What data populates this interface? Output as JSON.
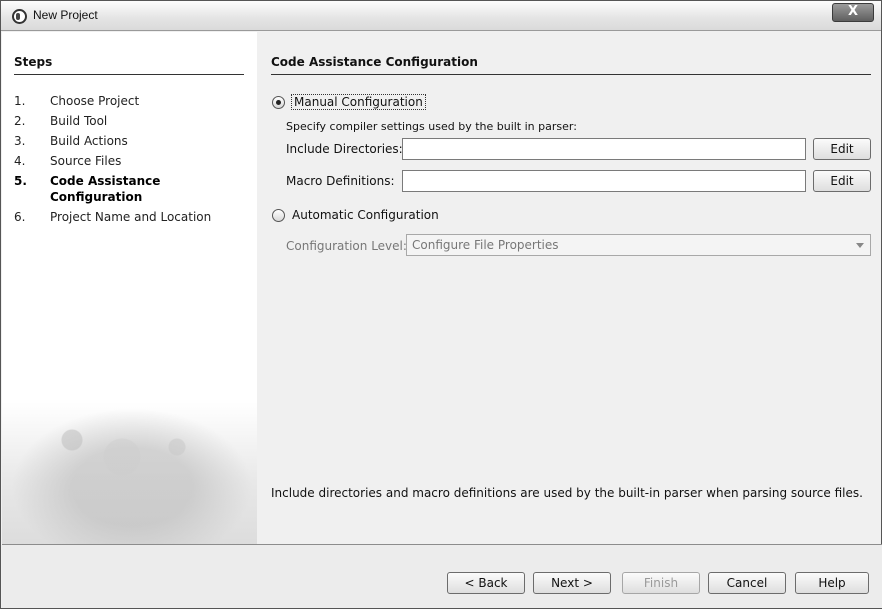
{
  "window": {
    "title": "New Project",
    "close_label": "X"
  },
  "steps": {
    "title": "Steps",
    "items": [
      {
        "num": "1.",
        "label": "Choose Project"
      },
      {
        "num": "2.",
        "label": "Build Tool"
      },
      {
        "num": "3.",
        "label": "Build Actions"
      },
      {
        "num": "4.",
        "label": "Source Files"
      },
      {
        "num": "5.",
        "label": "Code Assistance Configuration",
        "current": true
      },
      {
        "num": "6.",
        "label": "Project Name and Location"
      }
    ]
  },
  "main": {
    "title": "Code Assistance Configuration",
    "manual": {
      "label": "Manual Configuration",
      "selected": true,
      "hint": "Specify compiler settings used by the built in parser:",
      "include_label": "Include Directories:",
      "include_value": "",
      "include_edit": "Edit",
      "macro_label": "Macro Definitions:",
      "macro_value": "",
      "macro_edit": "Edit"
    },
    "automatic": {
      "label": "Automatic Configuration",
      "selected": false,
      "level_label": "Configuration Level:",
      "level_value": "Configure File Properties"
    },
    "description": "Include directories and macro definitions are used by the built-in parser when parsing source files."
  },
  "footer": {
    "back": "< Back",
    "next": "Next >",
    "finish": "Finish",
    "cancel": "Cancel",
    "help": "Help"
  }
}
